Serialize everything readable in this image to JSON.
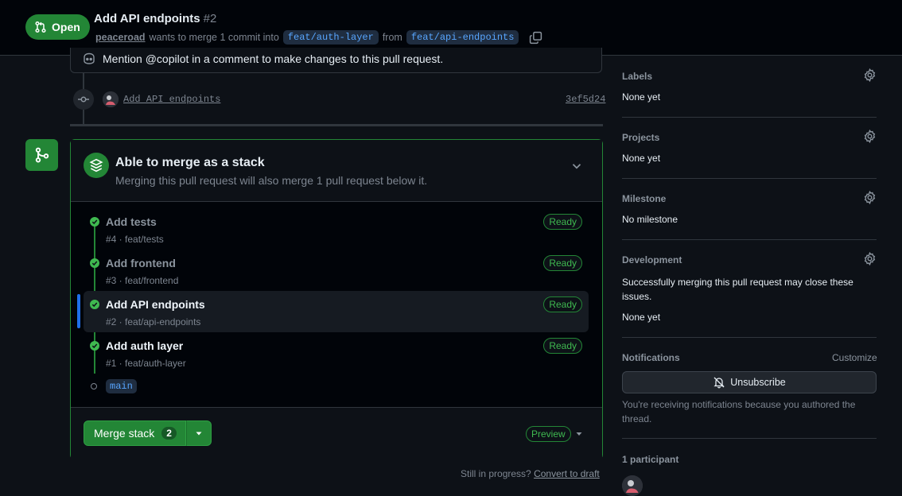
{
  "header": {
    "state_label": "Open",
    "title": "Add API endpoints",
    "number": "#2",
    "author": "peaceroad",
    "merge_text_1": "wants to merge 1 commit into",
    "base_branch": "feat/auth-layer",
    "merge_text_2": "from",
    "head_branch": "feat/api-endpoints"
  },
  "timeline": {
    "copilot_hint": "Mention @copilot in a comment to make changes to this pull request.",
    "commit_message": "Add API endpoints",
    "commit_sha": "3ef5d24"
  },
  "merge_box": {
    "title": "Able to merge as a stack",
    "subtitle": "Merging this pull request will also merge 1 pull request below it.",
    "stack": [
      {
        "title": "Add tests",
        "meta": "#4 · feat/tests",
        "status": "Ready"
      },
      {
        "title": "Add frontend",
        "meta": "#3 · feat/frontend",
        "status": "Ready"
      },
      {
        "title": "Add API endpoints",
        "meta": "#2 · feat/api-endpoints",
        "status": "Ready"
      },
      {
        "title": "Add auth layer",
        "meta": "#1 · feat/auth-layer",
        "status": "Ready"
      }
    ],
    "base_label": "main",
    "merge_button_label": "Merge stack",
    "merge_count": "2",
    "preview_label": "Preview"
  },
  "footer": {
    "draft_prompt": "Still in progress?",
    "draft_link": "Convert to draft"
  },
  "sidebar": {
    "labels": {
      "heading": "Labels",
      "value": "None yet"
    },
    "projects": {
      "heading": "Projects",
      "value": "None yet"
    },
    "milestone": {
      "heading": "Milestone",
      "value": "No milestone"
    },
    "development": {
      "heading": "Development",
      "description": "Successfully merging this pull request may close these issues.",
      "value": "None yet"
    },
    "notifications": {
      "heading": "Notifications",
      "customize": "Customize",
      "unsubscribe_label": "Unsubscribe",
      "reason": "You're receiving notifications because you authored the thread."
    },
    "participants": {
      "heading": "1 participant"
    }
  },
  "colors": {
    "background": "#0d1117",
    "accent_green": "#238636",
    "ready_green": "#3fb950",
    "link_blue": "#58a6ff",
    "current_marker": "#1f6feb"
  }
}
